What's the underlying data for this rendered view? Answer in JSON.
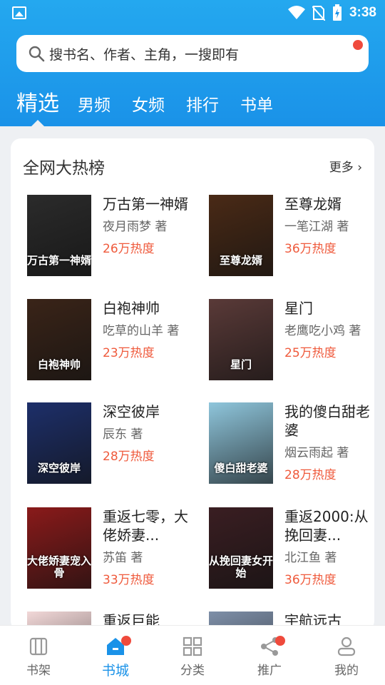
{
  "status": {
    "time": "3:38"
  },
  "search": {
    "placeholder": "搜书名、作者、主角，一搜即有"
  },
  "tabs": [
    {
      "label": "精选",
      "active": true
    },
    {
      "label": "男频"
    },
    {
      "label": "女频"
    },
    {
      "label": "排行"
    },
    {
      "label": "书单"
    }
  ],
  "section": {
    "title": "全网大热榜",
    "more": "更多"
  },
  "books": [
    {
      "name": "万古第一神婿",
      "author": "夜月雨梦 著",
      "heat": "26万热度",
      "cover_text": "万古第一神婿",
      "cover_color": "#2b2b2b"
    },
    {
      "name": "至尊龙婿",
      "author": "一笔江湖 著",
      "heat": "36万热度",
      "cover_text": "至尊龙婿",
      "cover_color": "#4a2a16"
    },
    {
      "name": "白袍神帅",
      "author": "吃草的山羊 著",
      "heat": "23万热度",
      "cover_text": "白袍神帅",
      "cover_color": "#3a2418"
    },
    {
      "name": "星门",
      "author": "老鹰吃小鸡 著",
      "heat": "25万热度",
      "cover_text": "星门",
      "cover_color": "#5a3a38"
    },
    {
      "name": "深空彼岸",
      "author": "辰东 著",
      "heat": "28万热度",
      "cover_text": "深空彼岸",
      "cover_color": "#1d2f6a"
    },
    {
      "name": "我的傻白甜老婆",
      "author": "烟云雨起 著",
      "heat": "28万热度",
      "cover_text": "傻白甜老婆",
      "cover_color": "#8fc6dc"
    },
    {
      "name": "重返七零，大佬娇妻...",
      "author": "苏笛 著",
      "heat": "33万热度",
      "cover_text": "大佬娇妻宠入骨",
      "cover_color": "#8a1a1a"
    },
    {
      "name": "重返2000:从挽回妻...",
      "author": "北江鱼 著",
      "heat": "36万热度",
      "cover_text": "从挽回妻女开始",
      "cover_color": "#3a1e22"
    },
    {
      "name": "重返巨能",
      "author": "",
      "heat": "",
      "cover_text": "",
      "cover_color": "#f2d8d8"
    },
    {
      "name": "宇航远古",
      "author": "",
      "heat": "",
      "cover_text": "",
      "cover_color": "#7e8fa8"
    }
  ],
  "bottom_nav": [
    {
      "label": "书架",
      "icon": "bookshelf-icon",
      "dot": false
    },
    {
      "label": "书城",
      "icon": "bookstore-icon",
      "dot": true,
      "active": true
    },
    {
      "label": "分类",
      "icon": "category-icon",
      "dot": false
    },
    {
      "label": "推广",
      "icon": "share-icon",
      "dot": true
    },
    {
      "label": "我的",
      "icon": "profile-icon",
      "dot": false
    }
  ],
  "colors": {
    "brand": "#1a92e8",
    "accent": "#ef5a3c",
    "badge": "#ef4a3c"
  }
}
